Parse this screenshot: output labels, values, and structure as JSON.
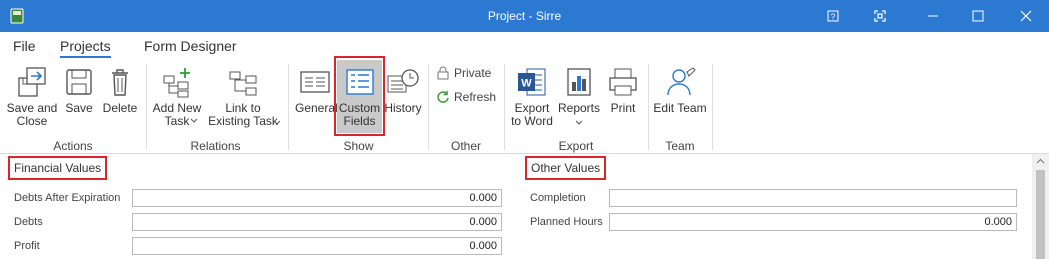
{
  "window": {
    "title": "Project - Sirre"
  },
  "menu": {
    "tabs": [
      "File",
      "Projects",
      "Form Designer"
    ]
  },
  "ribbon": {
    "actions": {
      "save_close": "Save and\nClose",
      "save": "Save",
      "delete": "Delete",
      "group": "Actions"
    },
    "relations": {
      "add_task": "Add New\nTask",
      "link_task": "Link to\nExisting Task",
      "group": "Relations"
    },
    "show": {
      "general": "General",
      "custom_fields": "Custom\nFields",
      "history": "History",
      "group": "Show"
    },
    "other": {
      "private": "Private",
      "refresh": "Refresh",
      "group": "Other"
    },
    "export": {
      "export_word": "Export\nto Word",
      "reports": "Reports",
      "print": "Print",
      "group": "Export"
    },
    "team": {
      "edit_team": "Edit Team",
      "group": "Team"
    }
  },
  "form": {
    "financial": {
      "title": "Financial Values",
      "fields": [
        {
          "label": "Debts After Expiration",
          "value": "0.000"
        },
        {
          "label": "Debts",
          "value": "0.000"
        },
        {
          "label": "Profit",
          "value": "0.000"
        }
      ]
    },
    "other": {
      "title": "Other Values",
      "fields": [
        {
          "label": "Completion",
          "value": ""
        },
        {
          "label": "Planned Hours",
          "value": "0.000"
        }
      ]
    }
  },
  "colors": {
    "titlebar": "#2b79d0",
    "highlight": "#d9262c"
  }
}
